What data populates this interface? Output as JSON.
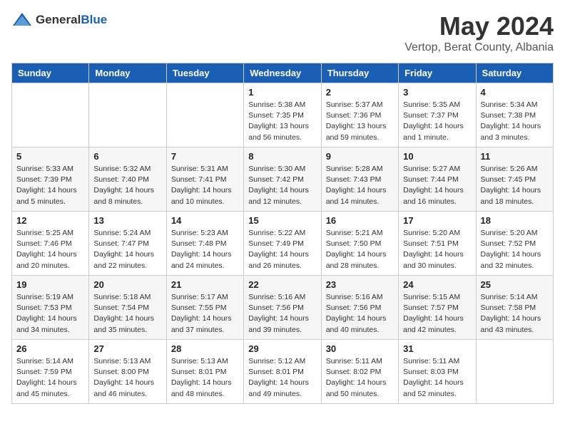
{
  "header": {
    "logo_general": "General",
    "logo_blue": "Blue",
    "month_title": "May 2024",
    "location": "Vertop, Berat County, Albania"
  },
  "calendar": {
    "days_of_week": [
      "Sunday",
      "Monday",
      "Tuesday",
      "Wednesday",
      "Thursday",
      "Friday",
      "Saturday"
    ],
    "weeks": [
      [
        {
          "day": "",
          "sunrise": "",
          "sunset": "",
          "daylight": ""
        },
        {
          "day": "",
          "sunrise": "",
          "sunset": "",
          "daylight": ""
        },
        {
          "day": "",
          "sunrise": "",
          "sunset": "",
          "daylight": ""
        },
        {
          "day": "1",
          "sunrise": "Sunrise: 5:38 AM",
          "sunset": "Sunset: 7:35 PM",
          "daylight": "Daylight: 13 hours and 56 minutes."
        },
        {
          "day": "2",
          "sunrise": "Sunrise: 5:37 AM",
          "sunset": "Sunset: 7:36 PM",
          "daylight": "Daylight: 13 hours and 59 minutes."
        },
        {
          "day": "3",
          "sunrise": "Sunrise: 5:35 AM",
          "sunset": "Sunset: 7:37 PM",
          "daylight": "Daylight: 14 hours and 1 minute."
        },
        {
          "day": "4",
          "sunrise": "Sunrise: 5:34 AM",
          "sunset": "Sunset: 7:38 PM",
          "daylight": "Daylight: 14 hours and 3 minutes."
        }
      ],
      [
        {
          "day": "5",
          "sunrise": "Sunrise: 5:33 AM",
          "sunset": "Sunset: 7:39 PM",
          "daylight": "Daylight: 14 hours and 5 minutes."
        },
        {
          "day": "6",
          "sunrise": "Sunrise: 5:32 AM",
          "sunset": "Sunset: 7:40 PM",
          "daylight": "Daylight: 14 hours and 8 minutes."
        },
        {
          "day": "7",
          "sunrise": "Sunrise: 5:31 AM",
          "sunset": "Sunset: 7:41 PM",
          "daylight": "Daylight: 14 hours and 10 minutes."
        },
        {
          "day": "8",
          "sunrise": "Sunrise: 5:30 AM",
          "sunset": "Sunset: 7:42 PM",
          "daylight": "Daylight: 14 hours and 12 minutes."
        },
        {
          "day": "9",
          "sunrise": "Sunrise: 5:28 AM",
          "sunset": "Sunset: 7:43 PM",
          "daylight": "Daylight: 14 hours and 14 minutes."
        },
        {
          "day": "10",
          "sunrise": "Sunrise: 5:27 AM",
          "sunset": "Sunset: 7:44 PM",
          "daylight": "Daylight: 14 hours and 16 minutes."
        },
        {
          "day": "11",
          "sunrise": "Sunrise: 5:26 AM",
          "sunset": "Sunset: 7:45 PM",
          "daylight": "Daylight: 14 hours and 18 minutes."
        }
      ],
      [
        {
          "day": "12",
          "sunrise": "Sunrise: 5:25 AM",
          "sunset": "Sunset: 7:46 PM",
          "daylight": "Daylight: 14 hours and 20 minutes."
        },
        {
          "day": "13",
          "sunrise": "Sunrise: 5:24 AM",
          "sunset": "Sunset: 7:47 PM",
          "daylight": "Daylight: 14 hours and 22 minutes."
        },
        {
          "day": "14",
          "sunrise": "Sunrise: 5:23 AM",
          "sunset": "Sunset: 7:48 PM",
          "daylight": "Daylight: 14 hours and 24 minutes."
        },
        {
          "day": "15",
          "sunrise": "Sunrise: 5:22 AM",
          "sunset": "Sunset: 7:49 PM",
          "daylight": "Daylight: 14 hours and 26 minutes."
        },
        {
          "day": "16",
          "sunrise": "Sunrise: 5:21 AM",
          "sunset": "Sunset: 7:50 PM",
          "daylight": "Daylight: 14 hours and 28 minutes."
        },
        {
          "day": "17",
          "sunrise": "Sunrise: 5:20 AM",
          "sunset": "Sunset: 7:51 PM",
          "daylight": "Daylight: 14 hours and 30 minutes."
        },
        {
          "day": "18",
          "sunrise": "Sunrise: 5:20 AM",
          "sunset": "Sunset: 7:52 PM",
          "daylight": "Daylight: 14 hours and 32 minutes."
        }
      ],
      [
        {
          "day": "19",
          "sunrise": "Sunrise: 5:19 AM",
          "sunset": "Sunset: 7:53 PM",
          "daylight": "Daylight: 14 hours and 34 minutes."
        },
        {
          "day": "20",
          "sunrise": "Sunrise: 5:18 AM",
          "sunset": "Sunset: 7:54 PM",
          "daylight": "Daylight: 14 hours and 35 minutes."
        },
        {
          "day": "21",
          "sunrise": "Sunrise: 5:17 AM",
          "sunset": "Sunset: 7:55 PM",
          "daylight": "Daylight: 14 hours and 37 minutes."
        },
        {
          "day": "22",
          "sunrise": "Sunrise: 5:16 AM",
          "sunset": "Sunset: 7:56 PM",
          "daylight": "Daylight: 14 hours and 39 minutes."
        },
        {
          "day": "23",
          "sunrise": "Sunrise: 5:16 AM",
          "sunset": "Sunset: 7:56 PM",
          "daylight": "Daylight: 14 hours and 40 minutes."
        },
        {
          "day": "24",
          "sunrise": "Sunrise: 5:15 AM",
          "sunset": "Sunset: 7:57 PM",
          "daylight": "Daylight: 14 hours and 42 minutes."
        },
        {
          "day": "25",
          "sunrise": "Sunrise: 5:14 AM",
          "sunset": "Sunset: 7:58 PM",
          "daylight": "Daylight: 14 hours and 43 minutes."
        }
      ],
      [
        {
          "day": "26",
          "sunrise": "Sunrise: 5:14 AM",
          "sunset": "Sunset: 7:59 PM",
          "daylight": "Daylight: 14 hours and 45 minutes."
        },
        {
          "day": "27",
          "sunrise": "Sunrise: 5:13 AM",
          "sunset": "Sunset: 8:00 PM",
          "daylight": "Daylight: 14 hours and 46 minutes."
        },
        {
          "day": "28",
          "sunrise": "Sunrise: 5:13 AM",
          "sunset": "Sunset: 8:01 PM",
          "daylight": "Daylight: 14 hours and 48 minutes."
        },
        {
          "day": "29",
          "sunrise": "Sunrise: 5:12 AM",
          "sunset": "Sunset: 8:01 PM",
          "daylight": "Daylight: 14 hours and 49 minutes."
        },
        {
          "day": "30",
          "sunrise": "Sunrise: 5:11 AM",
          "sunset": "Sunset: 8:02 PM",
          "daylight": "Daylight: 14 hours and 50 minutes."
        },
        {
          "day": "31",
          "sunrise": "Sunrise: 5:11 AM",
          "sunset": "Sunset: 8:03 PM",
          "daylight": "Daylight: 14 hours and 52 minutes."
        },
        {
          "day": "",
          "sunrise": "",
          "sunset": "",
          "daylight": ""
        }
      ]
    ]
  }
}
